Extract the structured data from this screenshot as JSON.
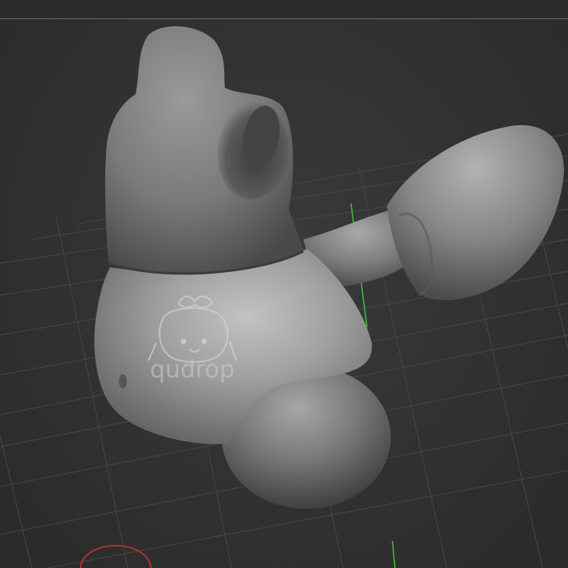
{
  "viewport": {
    "background": "#313131",
    "grid_color": "#464646",
    "axis_y_color": "#3fbf3f",
    "gizmo_color": "#b03030"
  },
  "model": {
    "base_color": "#8a8a8a",
    "shadow_color": "#3e3e3e",
    "highlight_color": "#c4c4c4"
  },
  "watermark": {
    "text": "qudrop",
    "icon": "girl-face-with-bow-icon"
  }
}
